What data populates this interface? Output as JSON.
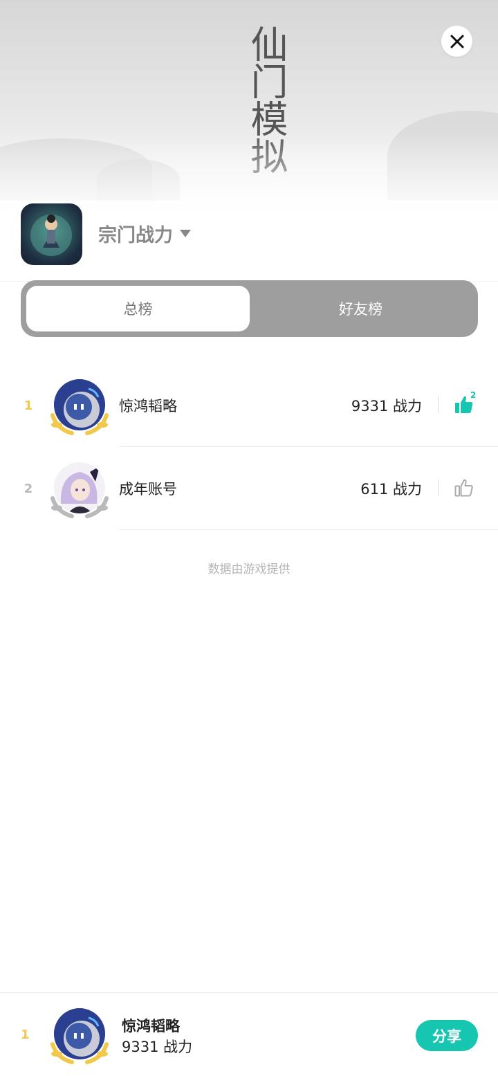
{
  "banner": {
    "title_text": "仙门模拟"
  },
  "close": {
    "icon": "close-icon"
  },
  "game": {
    "title": "宗门战力",
    "icon": "game-icon"
  },
  "tabs": [
    {
      "label": "总榜",
      "active": true
    },
    {
      "label": "好友榜",
      "active": false
    }
  ],
  "leaderboard": [
    {
      "rank": "1",
      "name": "惊鸿韬略",
      "score": "9331 战力",
      "likes": "2",
      "liked": true,
      "rank_color": "#f2c84b",
      "wreath": "gold"
    },
    {
      "rank": "2",
      "name": "成年账号",
      "score": "611 战力",
      "likes": "",
      "liked": false,
      "rank_color": "#b9b9b9",
      "wreath": "silver"
    }
  ],
  "footer_note": "数据由游戏提供",
  "me": {
    "rank": "1",
    "name": "惊鸿韬略",
    "score": "9331 战力",
    "share_label": "分享",
    "rank_color": "#f2c84b"
  },
  "colors": {
    "accent": "#17c6b1",
    "tab_bg": "#9e9e9e",
    "gold": "#f2c84b",
    "silver": "#b9b9b9"
  }
}
